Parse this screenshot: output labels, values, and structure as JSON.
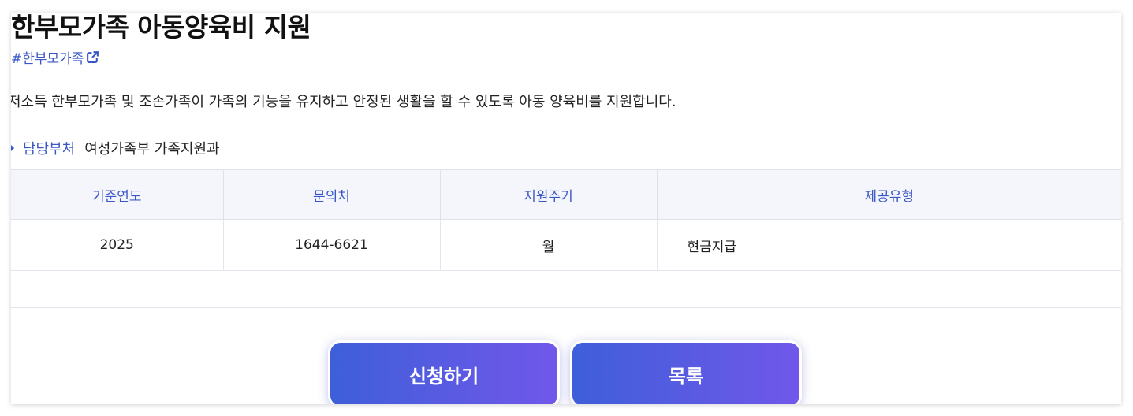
{
  "title": "한부모가족 아동양육비 지원",
  "tag": {
    "label": "#한부모가족",
    "icon": "external-link-icon"
  },
  "description": "저소득 한부모가족 및 조손가족이 가족의 기능을 유지하고 안정된 생활을 할 수 있도록 아동 양육비를 지원합니다.",
  "department": {
    "label": "담당부처",
    "value": "여성가족부 가족지원과"
  },
  "table": {
    "headers": [
      "기준연도",
      "문의처",
      "지원주기",
      "제공유형"
    ],
    "row": [
      "2025",
      "1644-6621",
      "월",
      "현금지급"
    ]
  },
  "buttons": {
    "apply": "신청하기",
    "list": "목록"
  },
  "colors": {
    "accent": "#3b57c7",
    "button_gradient_start": "#3e5fd9",
    "button_gradient_end": "#7157ea",
    "table_header_bg": "#f4f6fb"
  }
}
